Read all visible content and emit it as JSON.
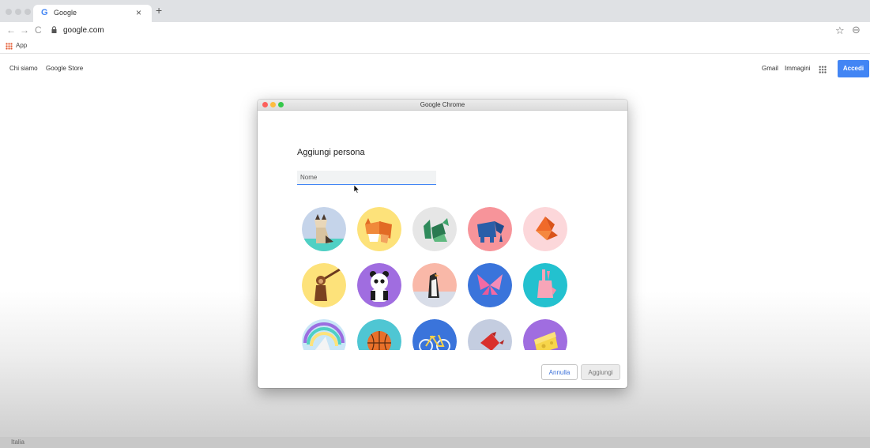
{
  "browser": {
    "tab": {
      "title": "Google",
      "favicon": "G",
      "close": "×"
    },
    "new_tab": "+",
    "nav": {
      "back": "←",
      "forward": "→",
      "reload": "C"
    },
    "url": "google.com",
    "star": "☆",
    "profile": "⊖",
    "bookmarks": {
      "apps_label": "App"
    }
  },
  "google": {
    "left_links": [
      "Chi siamo",
      "Google Store"
    ],
    "right_links": [
      "Gmail",
      "Immagini"
    ],
    "signin_label": "Accedi",
    "signin_color": "#4285f4",
    "footer_country": "Italia"
  },
  "dialog": {
    "window_title": "Google Chrome",
    "heading": "Aggiungi persona",
    "name_placeholder": "Nome",
    "cancel_label": "Annulla",
    "add_label": "Aggiungi",
    "avatars": [
      {
        "name": "cat-avatar",
        "bg": "#c5d4ea"
      },
      {
        "name": "fox-avatar",
        "bg": "#fde27a"
      },
      {
        "name": "dragon-avatar",
        "bg": "#e6e6e6"
      },
      {
        "name": "elephant-avatar",
        "bg": "#f7949a"
      },
      {
        "name": "fox-origami-avatar",
        "bg": "#fcd7da"
      },
      {
        "name": "monkey-avatar",
        "bg": "#fde27a"
      },
      {
        "name": "panda-avatar",
        "bg": "#a06de0"
      },
      {
        "name": "penguin-avatar",
        "bg": "#f9b8a8"
      },
      {
        "name": "butterfly-avatar",
        "bg": "#3a74db"
      },
      {
        "name": "rabbit-avatar",
        "bg": "#23c1cf"
      },
      {
        "name": "unicorn-avatar",
        "bg": "#c9e6f7"
      },
      {
        "name": "basketball-avatar",
        "bg": "#4fc6d3"
      },
      {
        "name": "bicycle-avatar",
        "bg": "#3a74db"
      },
      {
        "name": "bird-avatar",
        "bg": "#c4cde0"
      },
      {
        "name": "cheese-avatar",
        "bg": "#a06de0"
      }
    ]
  }
}
